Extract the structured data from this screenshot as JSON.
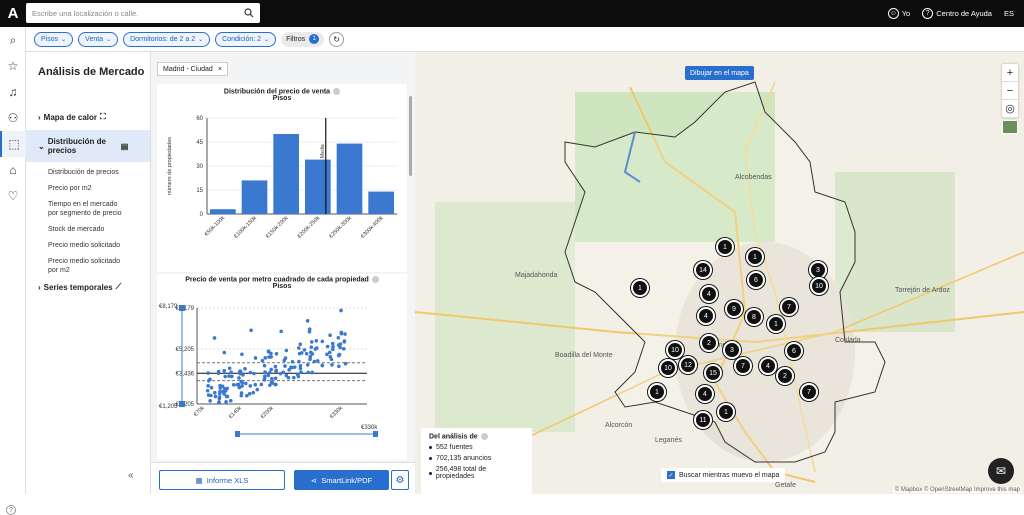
{
  "topbar": {
    "logo": "A",
    "search_placeholder": "Escribe una localización o calle.",
    "user": "Yo",
    "help": "Centro de Ayuda",
    "lang": "ES"
  },
  "filters": {
    "chips": [
      "Pisos",
      "Venta",
      "Dormitorios: de 2 a 2",
      "Condición: 2"
    ],
    "filtros_label": "Filtros",
    "filtros_count": "1"
  },
  "panel": {
    "title": "Análisis de Mercado",
    "heatmap": "Mapa de calor",
    "distribution_section": "Distribución de precios",
    "items": [
      "Distribución de precios",
      "Precio por m2",
      "Tiempo en el mercado por segmento de precio",
      "Stock de mercado",
      "Precio medio solicitado",
      "Precio medio solicitado por m2"
    ],
    "time_series": "Series temporales",
    "collapse": "«"
  },
  "content": {
    "location_tag": "Madrid - Ciudad",
    "xls": "Informe XLS",
    "smartlink": "SmartLink/PDF"
  },
  "chart_data": [
    {
      "type": "bar",
      "title": "Distribución del precio de venta",
      "subtitle": "Pisos",
      "ylabel": "número de propiedades",
      "xlabel": "",
      "categories": [
        "€50k-100k",
        "€100k-150k",
        "€150k-200k",
        "€200k-250k",
        "€250k-300k",
        "€300k-400k"
      ],
      "values": [
        3,
        21,
        50,
        34,
        44,
        14
      ],
      "ylim": [
        0,
        60
      ],
      "yticks": [
        0,
        15,
        30,
        45,
        60
      ],
      "median_label": "Media",
      "median_category_index": 3
    },
    {
      "type": "scatter",
      "title": "Precio de venta por metro cuadrado de cada propiedad",
      "subtitle": "Pisos",
      "yticks": [
        "€1,205",
        "€3,436",
        "€5,205",
        "€8,179"
      ],
      "xticks": [
        "€70k",
        "€140k",
        "€200k",
        "€330k"
      ],
      "range_min": "€1,205",
      "range_max": "€8,179",
      "slider_max": "€330k",
      "ylim": [
        1205,
        8179
      ],
      "xlim": [
        60000,
        380000
      ]
    }
  ],
  "map": {
    "draw_button": "Dibujar en el mapa",
    "stats_title": "Del análisis de",
    "stats": [
      "552 fuentes",
      "702,135 anuncios",
      "256,498 total de propiedades"
    ],
    "move_search": "Buscar mientras muevo el mapa",
    "attribution": "© Mapbox © OpenStreetMap  Improve this map",
    "markers": [
      "1",
      "1",
      "3",
      "1",
      "14",
      "6",
      "10",
      "4",
      "9",
      "8",
      "1",
      "7",
      "4",
      "10",
      "2",
      "3",
      "6",
      "10",
      "12",
      "15",
      "7",
      "4",
      "2",
      "7",
      "1",
      "4",
      "11",
      "1"
    ],
    "place_labels": [
      "Alcobendas",
      "Madrid",
      "Boadilla del Monte",
      "Majadahonda",
      "Alcorcón",
      "Leganés",
      "Coslada",
      "Torrejón de Ardoz",
      "Getafe"
    ]
  }
}
